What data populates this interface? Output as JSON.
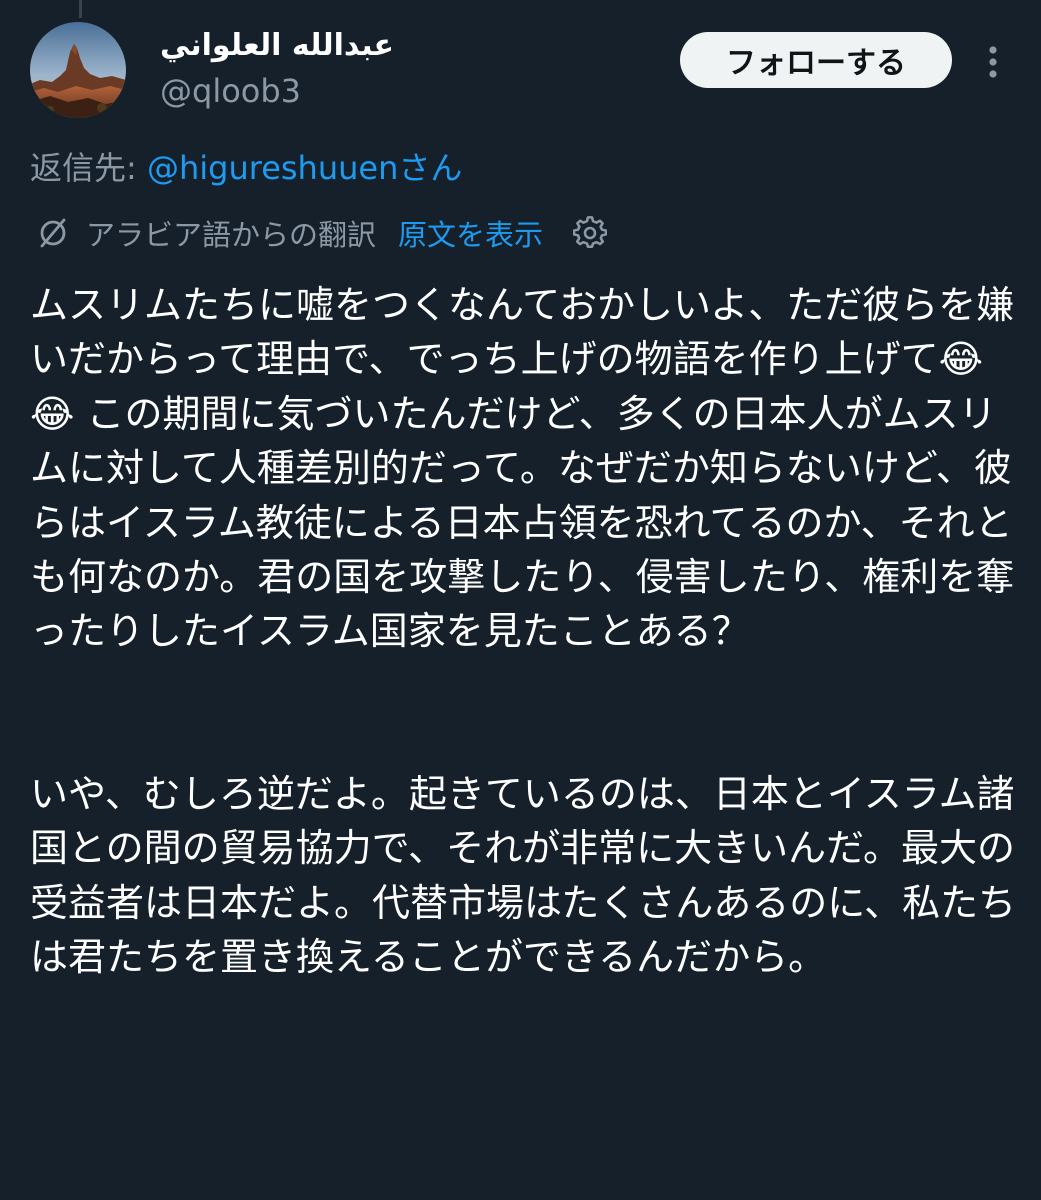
{
  "author": {
    "display_name": "عبدالله العلواني",
    "handle": "@qloob3",
    "avatar_icon": "desert-rock-landscape-avatar"
  },
  "actions": {
    "follow_label": "フォローする",
    "more_icon": "vertical-ellipsis-icon"
  },
  "reply": {
    "prefix": "返信先: ",
    "mention": "@higureshuuenさん"
  },
  "translation": {
    "label": "アラビア語からの翻訳",
    "show_original": "原文を表示",
    "translate_icon": "translate-globe-icon",
    "settings_icon": "gear-icon"
  },
  "tweet": {
    "paragraph_1": "ムスリムたちに嘘をつくなんておかしいよ、ただ彼らを嫌いだからって理由で、でっち上げの物語を作り上げて😂😂 この期間に気づいたんだけど、多くの日本人がムスリムに対して人種差別的だって。なぜだか知らないけど、彼らはイスラム教徒による日本占領を恐れてるのか、それとも何なのか。君の国を攻撃したり、侵害したり、権利を奪ったりしたイスラム国家を見たことある？",
    "paragraph_2": "いや、むしろ逆だよ。起きているのは、日本とイスラム諸国との間の貿易協力で、それが非常に大きいんだ。最大の受益者は日本だよ。代替市場はたくさんあるのに、私たちは君たちを置き換えることができるんだから。"
  },
  "colors": {
    "background": "#15202b",
    "text_primary": "#ffffff",
    "text_secondary": "#8b98a5",
    "link_blue": "#1d9bf0",
    "follow_button_bg": "#eff3f4",
    "follow_button_text": "#0f1419"
  }
}
